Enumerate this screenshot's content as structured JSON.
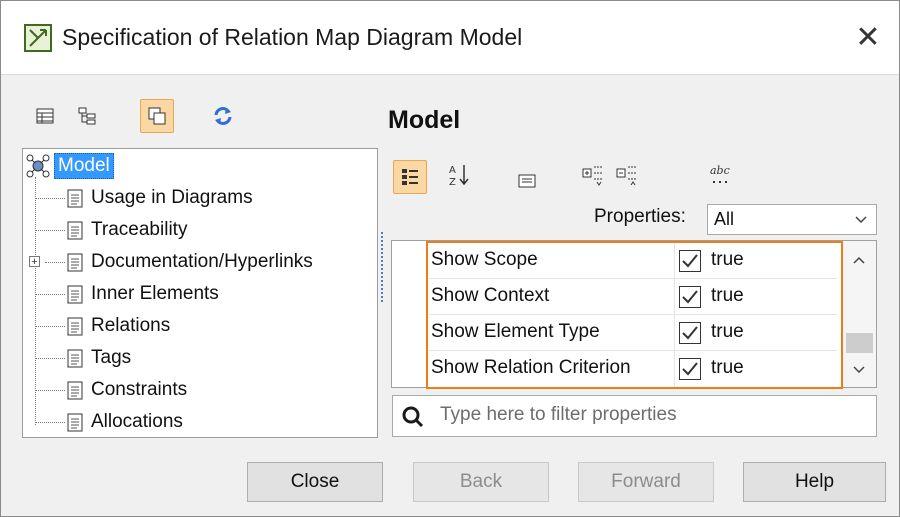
{
  "window": {
    "title": "Specification of Relation Map Diagram Model"
  },
  "left_toolbar": {
    "icons": [
      "table-icon",
      "tree-view-icon",
      "copy-icon",
      "refresh-icon"
    ]
  },
  "tree": {
    "root": "Model",
    "items": [
      {
        "label": "Usage in Diagrams",
        "expandable": false
      },
      {
        "label": "Traceability",
        "expandable": false
      },
      {
        "label": "Documentation/Hyperlinks",
        "expandable": true
      },
      {
        "label": "Inner Elements",
        "expandable": false
      },
      {
        "label": "Relations",
        "expandable": false
      },
      {
        "label": "Tags",
        "expandable": false
      },
      {
        "label": "Constraints",
        "expandable": false
      },
      {
        "label": "Allocations",
        "expandable": false
      }
    ]
  },
  "main": {
    "title": "Model",
    "toolbar_icons": [
      "categorized-view-icon",
      "sort-alphabetically-icon",
      "compact-view-icon",
      "expand-all-icon",
      "collapse-all-icon",
      "show-text-icon"
    ],
    "properties_label": "Properties:",
    "properties_value": "All",
    "rows": [
      {
        "name": "Show Scope",
        "checked": true,
        "value": "true"
      },
      {
        "name": "Show Context",
        "checked": true,
        "value": "true"
      },
      {
        "name": "Show Element Type",
        "checked": true,
        "value": "true"
      },
      {
        "name": "Show Relation Criterion",
        "checked": true,
        "value": "true"
      }
    ],
    "filter_placeholder": "Type here to filter properties"
  },
  "buttons": {
    "close": "Close",
    "back": "Back",
    "forward": "Forward",
    "help": "Help"
  },
  "colors": {
    "highlight": "#ee7d16",
    "active_button": "#fbd7a3",
    "selection": "#3399ff"
  }
}
